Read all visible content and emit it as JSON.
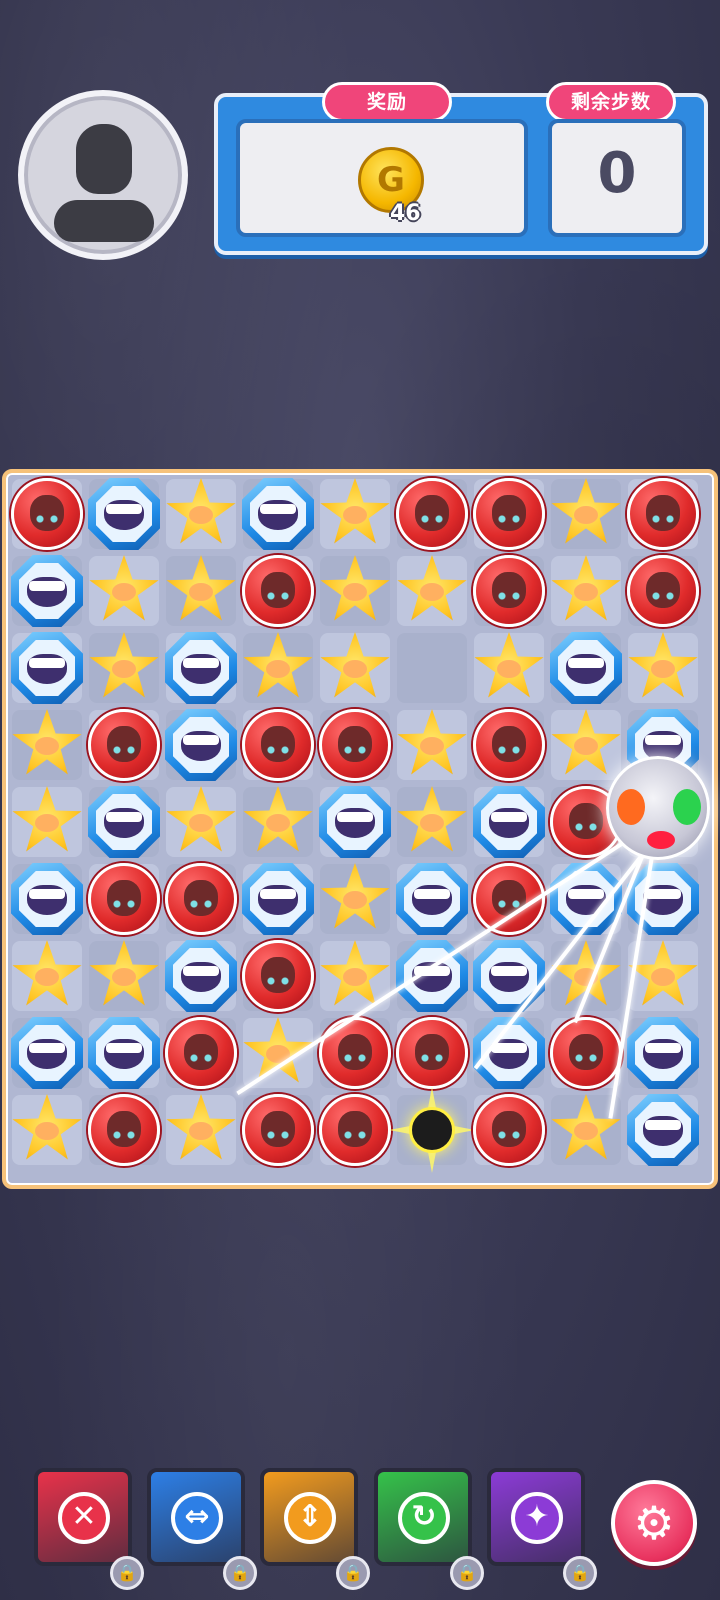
{
  "header": {
    "reward_label": "奖励",
    "moves_label": "剩余步数",
    "coin_symbol": "G",
    "coin_count": "46",
    "moves_remaining": "0"
  },
  "board": {
    "rows": 9,
    "cols": 9,
    "pieces": [
      [
        "red",
        "blue",
        "yellow",
        "blue",
        "yellow",
        "red",
        "red",
        "yellow",
        "red"
      ],
      [
        "blue",
        "yellow",
        "yellow",
        "red",
        "yellow",
        "yellow",
        "red",
        "yellow",
        "red"
      ],
      [
        "blue",
        "yellow",
        "blue",
        "yellow",
        "yellow",
        "empty",
        "yellow",
        "blue",
        "yellow"
      ],
      [
        "yellow",
        "red",
        "blue",
        "red",
        "red",
        "yellow",
        "red",
        "yellow",
        "blue"
      ],
      [
        "yellow",
        "blue",
        "yellow",
        "yellow",
        "blue",
        "yellow",
        "blue",
        "red",
        "orb"
      ],
      [
        "blue",
        "red",
        "red",
        "blue",
        "yellow",
        "blue",
        "red",
        "blue",
        "blue"
      ],
      [
        "yellow",
        "yellow",
        "blue",
        "red",
        "yellow",
        "blue",
        "blue",
        "yellow",
        "yellow"
      ],
      [
        "blue",
        "blue",
        "red",
        "yellow",
        "red",
        "red",
        "blue",
        "red",
        "blue"
      ],
      [
        "yellow",
        "red",
        "yellow",
        "red",
        "red",
        "bomb",
        "red",
        "yellow",
        "blue"
      ]
    ]
  },
  "toolbar": {
    "tools": [
      {
        "name": "remove-tool",
        "glyph": "✕",
        "color": "#e8324a"
      },
      {
        "name": "swap-tool",
        "glyph": "⇔",
        "color": "#2d7fe6"
      },
      {
        "name": "vertical-tool",
        "glyph": "⇕",
        "color": "#f29b1e"
      },
      {
        "name": "shuffle-tool",
        "glyph": "↻",
        "color": "#35c24a"
      },
      {
        "name": "magic-tool",
        "glyph": "✦",
        "color": "#8c3bd6"
      }
    ],
    "lock_glyph": "🔒",
    "settings_glyph": "⚙"
  },
  "colors": {
    "panel_blue": "#2f8ae0",
    "label_pink": "#f0457a",
    "board_border": "#f6c27a",
    "settings_pink": "#e8325e"
  }
}
